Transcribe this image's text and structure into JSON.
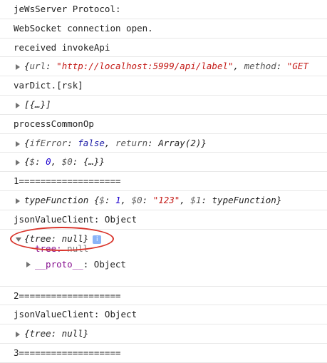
{
  "console": {
    "lines": [
      {
        "text": "jeWsServer Protocol:"
      },
      {
        "text": "WebSocket connection open."
      },
      {
        "text": "received invokeApi"
      },
      {
        "url_key": "url",
        "url_value": "\"http://localhost:5999/api/label\"",
        "method_key": "method",
        "method_value": "\"GET"
      },
      {
        "text": "varDict.[rsk]"
      },
      {
        "text": "[{…}]"
      },
      {
        "text": "processCommonOp"
      },
      {
        "if_key": "ifError",
        "if_value": "false",
        "ret_key": "return",
        "ret_value": "Array(2)"
      },
      {
        "d_key": "$",
        "d_value": "0",
        "d0_key": "$0",
        "d0_value": "{…}"
      },
      {
        "text": "1==================="
      },
      {
        "label": "typeFunction",
        "d_key": "$",
        "d_value": "1",
        "d0_key": "$0",
        "d0_value": "\"123\"",
        "d1_key": "$1",
        "d1_value": "typeFunction"
      },
      {
        "text": "jsonValueClient: Object"
      },
      {
        "summary": "{tree: null}",
        "badge": "i",
        "tree_key": "tree",
        "tree_value": "null",
        "proto_key": "__proto__",
        "proto_value": "Object"
      },
      {
        "text": "2==================="
      },
      {
        "text": "jsonValueClient: Object"
      },
      {
        "summary": "{tree: null}"
      },
      {
        "text": "3==================="
      }
    ]
  }
}
